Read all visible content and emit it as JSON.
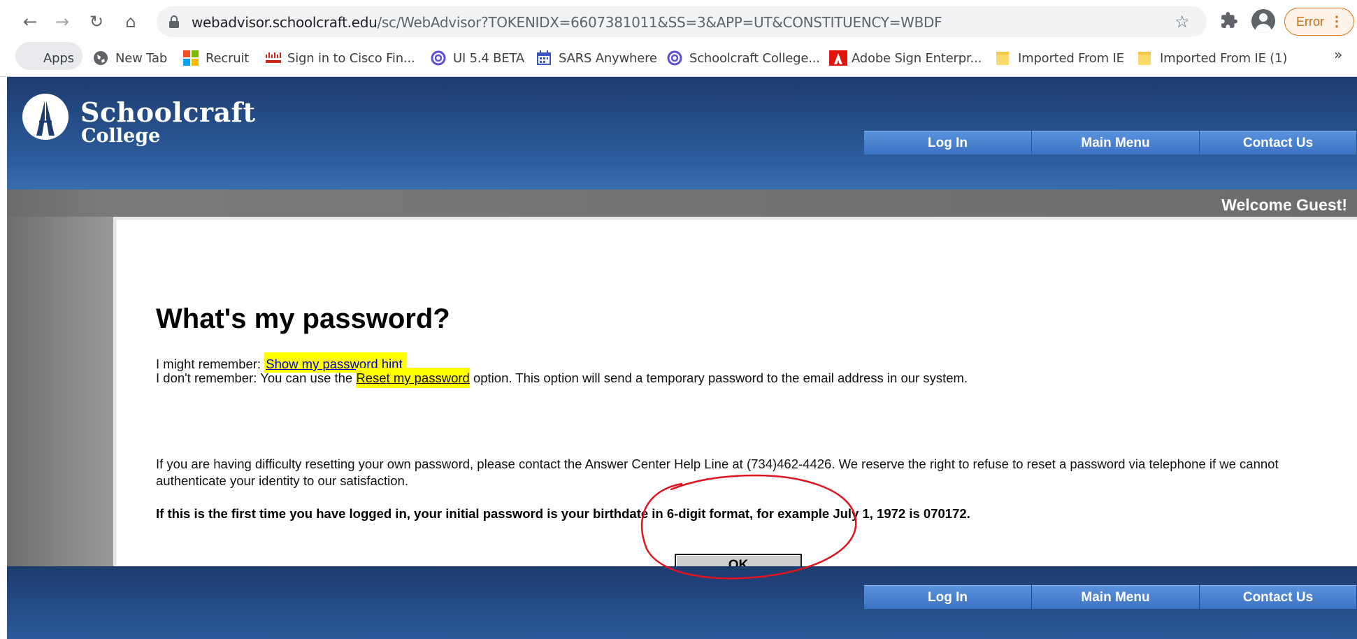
{
  "browser": {
    "url_host": "webadvisor.schoolcraft.edu",
    "url_path": "/sc/WebAdvisor?TOKENIDX=6607381011&SS=3&APP=UT&CONSTITUENCY=WBDF",
    "error_label": "Error",
    "bookmarks": [
      {
        "label": "Apps",
        "icon": "apps-grid-icon"
      },
      {
        "label": "New Tab",
        "icon": "globe-icon"
      },
      {
        "label": "Recruit",
        "icon": "microsoft-logo-icon"
      },
      {
        "label": "Sign in to Cisco Fin...",
        "icon": "cisco-logo-icon"
      },
      {
        "label": "UI 5.4 BETA",
        "icon": "circle-c-icon"
      },
      {
        "label": "SARS Anywhere",
        "icon": "calendar-icon"
      },
      {
        "label": "Schoolcraft College...",
        "icon": "circle-c-icon"
      },
      {
        "label": "Adobe Sign Enterpr...",
        "icon": "adobe-logo-icon"
      },
      {
        "label": "Imported From IE",
        "icon": "folder-icon"
      },
      {
        "label": "Imported From IE (1)",
        "icon": "folder-icon"
      }
    ]
  },
  "site": {
    "logo_line1": "Schoolcraft",
    "logo_line2": "College",
    "nav": [
      "Log In",
      "Main Menu",
      "Contact Us"
    ],
    "welcome": "Welcome Guest!"
  },
  "content": {
    "title": "What's my password?",
    "remember_prefix": "I might remember: ",
    "remember_link": "Show my password hint",
    "forgot_prefix": "I don't remember: You can use the ",
    "forgot_link": "Reset my password",
    "forgot_suffix": " option. This option will send a temporary password to the email address in our system.",
    "help_text": "If you are having difficulty resetting your own password, please contact the Answer Center Help Line at (734)462-4426. We reserve the right to refuse to reset a password via telephone if we cannot authenticate your identity to our satisfaction.",
    "first_time_text": "If this is the first time you have logged in, your initial password is your birthdate in 6-digit format, for example July 1, 1972 is 070172.",
    "ok_label": "OK"
  },
  "colors": {
    "highlight": "#ffff00",
    "annotation": "#e0141e",
    "header_blue": "#2c5a9a",
    "nav_blue": "#4a82d0"
  }
}
